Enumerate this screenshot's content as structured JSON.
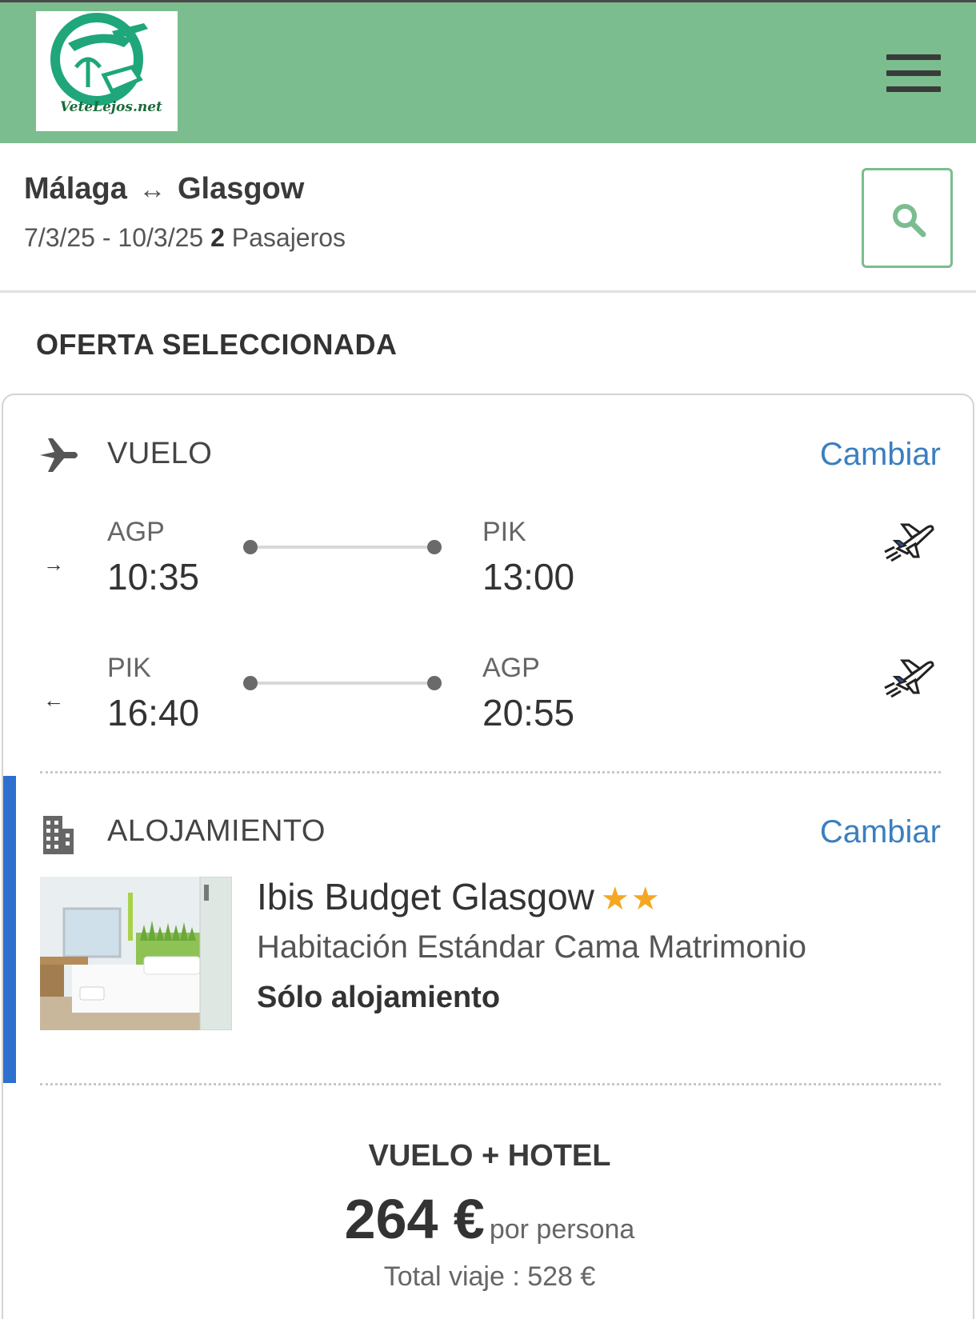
{
  "header": {
    "logo_text": "VeteLejos.net",
    "menu_icon": "hamburger-menu-icon",
    "brand_color": "#7bbd8f"
  },
  "search": {
    "origin": "Málaga",
    "destination": "Glasgow",
    "route_separator": "↔",
    "dates": "7/3/25 - 10/3/25",
    "passengers_count": "2",
    "passengers_label": "Pasajeros",
    "search_icon": "search-icon"
  },
  "offer": {
    "section_title": "OFERTA SELECCIONADA",
    "flight": {
      "label": "VUELO",
      "change_label": "Cambiar",
      "icon": "plane-icon",
      "outbound": {
        "direction_icon": "→",
        "from_code": "AGP",
        "from_time": "10:35",
        "to_code": "PIK",
        "to_time": "13:00"
      },
      "return": {
        "direction_icon": "←",
        "from_code": "PIK",
        "from_time": "16:40",
        "to_code": "AGP",
        "to_time": "20:55"
      }
    },
    "accommodation": {
      "label": "ALOJAMIENTO",
      "change_label": "Cambiar",
      "icon": "building-icon",
      "hotel_name": "Ibis Budget Glasgow",
      "stars": "★★",
      "room_type": "Habitación Estándar Cama Matrimonio",
      "board": "Sólo alojamiento"
    },
    "summary": {
      "package_title": "VUELO + HOTEL",
      "price": "264 €",
      "price_unit": "por persona",
      "total": "Total viaje : 528 €"
    }
  },
  "colors": {
    "link": "#3a7fc0",
    "accent_bar": "#2f6fd0",
    "star": "#f5a623"
  }
}
